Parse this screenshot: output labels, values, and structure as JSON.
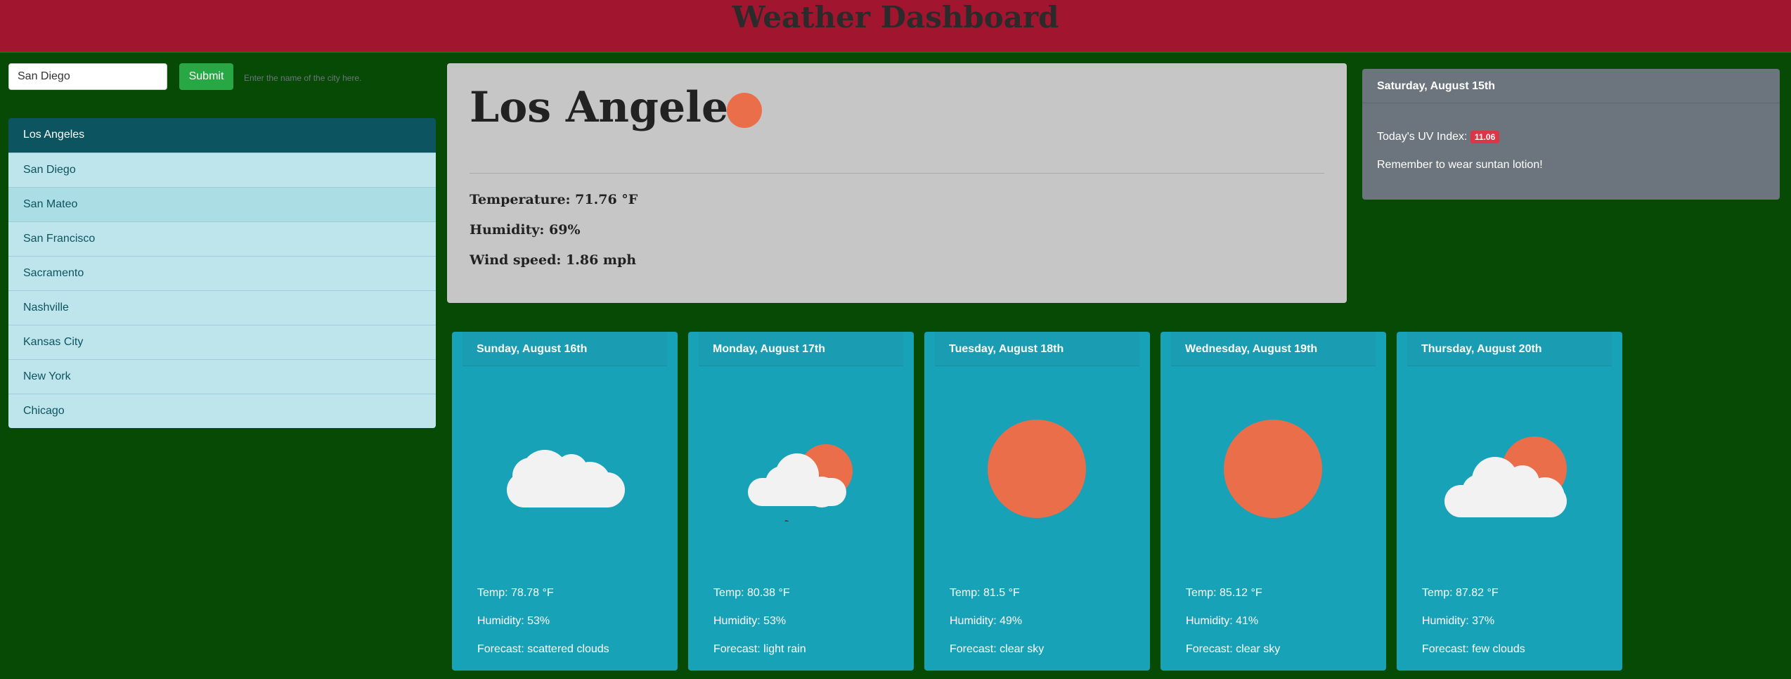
{
  "header": {
    "title": "Weather Dashboard"
  },
  "search": {
    "value": "San Diego",
    "submit_label": "Submit",
    "help": "Enter the name of the city here."
  },
  "cities": [
    "Los Angeles",
    "San Diego",
    "San Mateo",
    "San Francisco",
    "Sacramento",
    "Nashville",
    "Kansas City",
    "New York",
    "Chicago"
  ],
  "current": {
    "city": "Los Angeles",
    "icon": "sun-icon",
    "temperature": "Temperature: 71.76 °F",
    "humidity": "Humidity: 69%",
    "wind": "Wind speed: 1.86 mph"
  },
  "uv": {
    "date": "Saturday, August 15th",
    "label": "Today's UV Index:",
    "value": "11.06",
    "note": "Remember to wear suntan lotion!"
  },
  "forecast": [
    {
      "date": "Sunday, August 16th",
      "icon": "cloud-icon",
      "temp": "Temp: 78.78 °F",
      "humidity": "Humidity: 53%",
      "forecast": "Forecast: scattered clouds"
    },
    {
      "date": "Monday, August 17th",
      "icon": "rain-icon",
      "temp": "Temp: 80.38 °F",
      "humidity": "Humidity: 53%",
      "forecast": "Forecast: light rain"
    },
    {
      "date": "Tuesday, August 18th",
      "icon": "sun-icon",
      "temp": "Temp: 81.5 °F",
      "humidity": "Humidity: 49%",
      "forecast": "Forecast: clear sky"
    },
    {
      "date": "Wednesday, August 19th",
      "icon": "sun-icon",
      "temp": "Temp: 85.12 °F",
      "humidity": "Humidity: 41%",
      "forecast": "Forecast: clear sky"
    },
    {
      "date": "Thursday, August 20th",
      "icon": "partly-cloudy-icon",
      "temp": "Temp: 87.82 °F",
      "humidity": "Humidity: 37%",
      "forecast": "Forecast: few clouds"
    }
  ],
  "colors": {
    "background": "#074a05",
    "header": "#a1152f",
    "card": "#17a2b8",
    "sun": "#eb6e4b",
    "uv_badge": "#dc3545"
  }
}
